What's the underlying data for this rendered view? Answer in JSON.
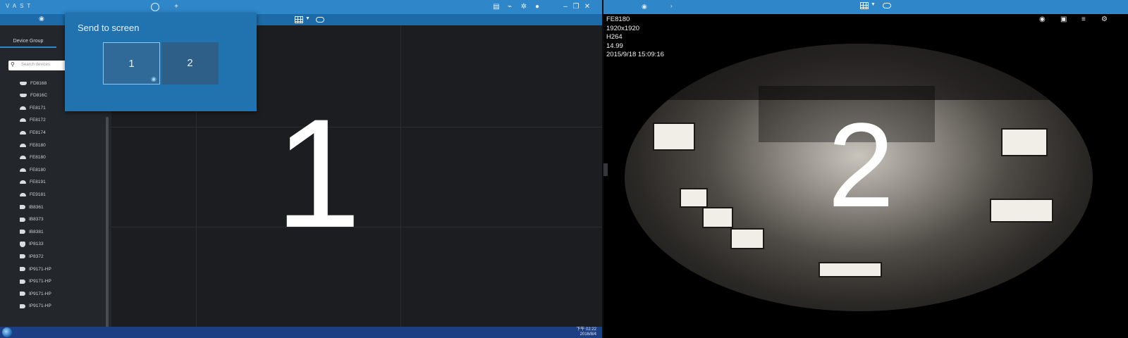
{
  "left_screen": {
    "app_logo": "VAST",
    "screen_number": "1",
    "sidebar": {
      "tab_label": "Device Group",
      "search_placeholder": "Search devices",
      "devices": [
        "FD8168",
        "FD816C",
        "FE8171",
        "FE8172",
        "FE8174",
        "FE8180",
        "FE8180",
        "FE8180",
        "FE8191",
        "FE9181",
        "IB8361",
        "IB8373",
        "IB8381",
        "IP8133",
        "IP8372",
        "IP9171-HP",
        "IP9171-HP",
        "IP9171-HP",
        "IP9171-HP"
      ]
    },
    "send_to_screen": {
      "title": "Send to screen",
      "screens": [
        "1",
        "2"
      ],
      "selected": "1"
    },
    "taskbar": {
      "time": "下午 02:22",
      "date": "2016/8/4"
    }
  },
  "right_screen": {
    "screen_number": "2",
    "osd": {
      "camera": "FE8180",
      "resolution": "1920x1920",
      "codec": "H264",
      "fps": "14.99",
      "timestamp": "2015/9/18 15:09:16"
    }
  },
  "colors": {
    "accent": "#2f86c8",
    "popup": "#2173b0",
    "taskbar": "#1c3f84"
  }
}
